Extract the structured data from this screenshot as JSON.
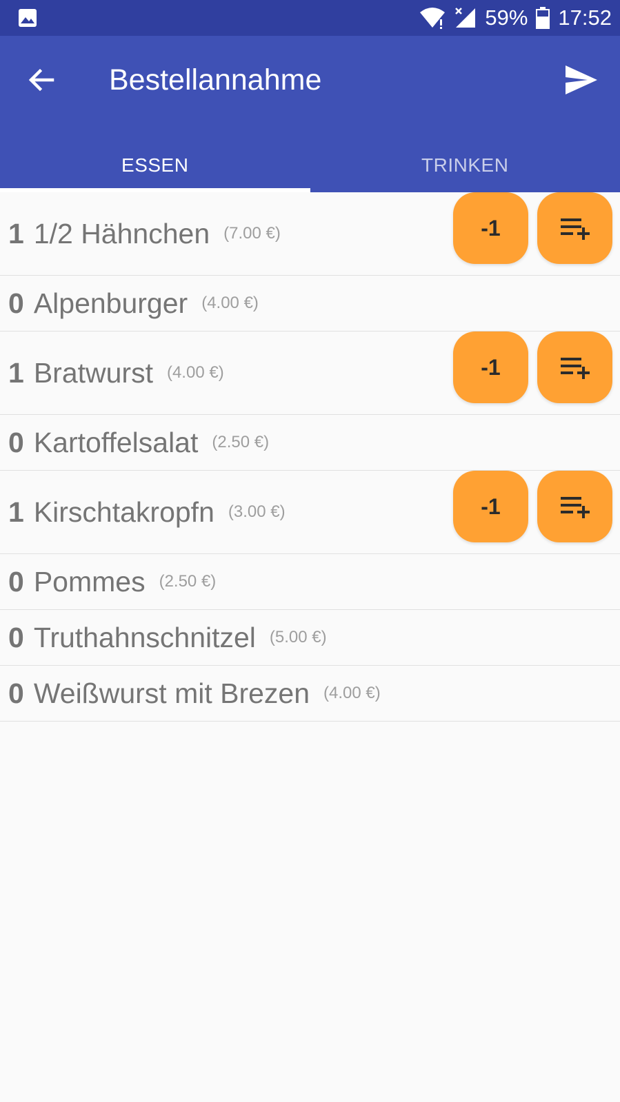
{
  "status_bar": {
    "battery": "59%",
    "time": "17:52",
    "icons": [
      "image-icon",
      "wifi-icon",
      "signal-icon",
      "battery-icon"
    ]
  },
  "app_bar": {
    "title": "Bestellannahme",
    "back_icon": "arrow-back-icon",
    "send_icon": "send-icon"
  },
  "tabs": [
    {
      "label": "ESSEN",
      "active": true
    },
    {
      "label": "TRINKEN",
      "active": false
    }
  ],
  "items": [
    {
      "qty": "1",
      "name": "1/2 Hähnchen",
      "price": "(7.00 €)",
      "minus_label": "-1",
      "has_buttons": true
    },
    {
      "qty": "0",
      "name": "Alpenburger",
      "price": "(4.00 €)",
      "has_buttons": false
    },
    {
      "qty": "1",
      "name": "Bratwurst",
      "price": "(4.00 €)",
      "minus_label": "-1",
      "has_buttons": true
    },
    {
      "qty": "0",
      "name": "Kartoffelsalat",
      "price": "(2.50 €)",
      "has_buttons": false
    },
    {
      "qty": "1",
      "name": "Kirschtakropfn",
      "price": "(3.00 €)",
      "minus_label": "-1",
      "has_buttons": true
    },
    {
      "qty": "0",
      "name": "Pommes",
      "price": "(2.50 €)",
      "has_buttons": false
    },
    {
      "qty": "0",
      "name": "Truthahnschnitzel",
      "price": "(5.00 €)",
      "has_buttons": false
    },
    {
      "qty": "0",
      "name": "Weißwurst mit Brezen",
      "price": "(4.00 €)",
      "has_buttons": false
    }
  ],
  "colors": {
    "status_bar": "#303f9f",
    "app_bar": "#3f51b5",
    "button": "#ffa133",
    "background": "#fafafa"
  }
}
